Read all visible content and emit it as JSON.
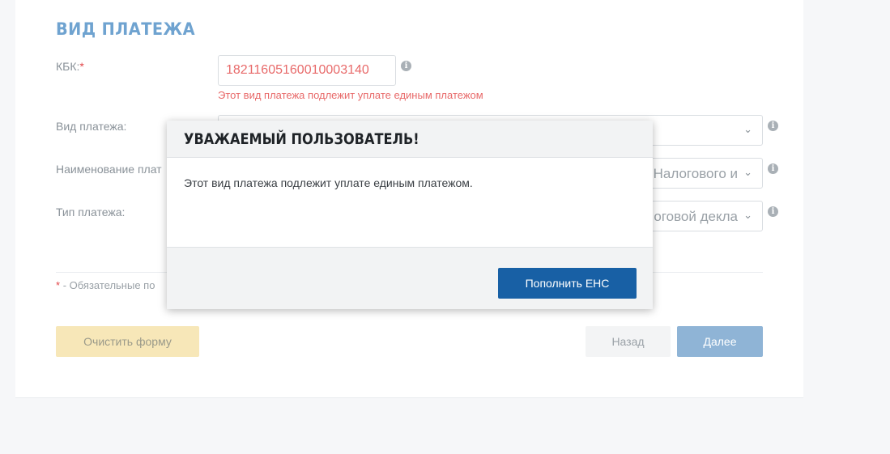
{
  "form": {
    "section_title": "ВИД ПЛАТЕЖА",
    "kbk_label": "КБК:",
    "required_mark": "*",
    "kbk_value": "18211605160010003140",
    "kbk_error": "Этот вид платежа подлежит уплате единым платежом",
    "payment_type_label": "Вид платежа:",
    "payment_type_value": "",
    "payment_name_label": "Наименование плат",
    "payment_name_value": "Налогового и",
    "payment_kind_label": "Тип платежа:",
    "payment_kind_value": "логовой декла",
    "required_note_mark": "*",
    "required_note": "- Обязательные по",
    "clear_button": "Очистить форму",
    "back_button": "Назад",
    "next_button": "Далее"
  },
  "modal": {
    "title": "УВАЖАЕМЫЙ ПОЛЬЗОВАТЕЛЬ!",
    "message": "Этот вид платежа подлежит уплате единым платежом.",
    "primary_button": "Пополнить ЕНС"
  },
  "colors": {
    "section_title": "#6fa3d0",
    "error": "#e86a6a",
    "primary": "#1860a5",
    "next_button": "#8fb4d6",
    "clear_button": "#f7e7b8"
  },
  "icons": {
    "info": "info-icon",
    "chevron": "chevron-down-icon"
  }
}
